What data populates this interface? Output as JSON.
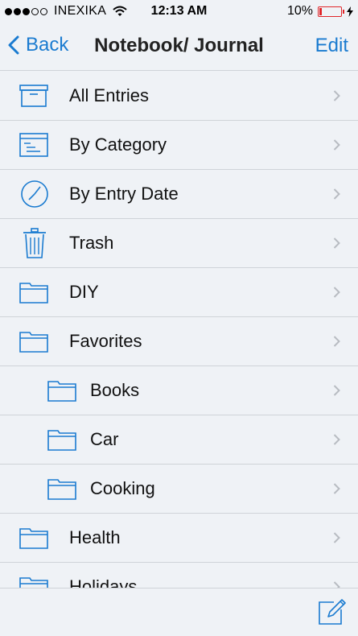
{
  "status_bar": {
    "carrier": "INEXIKA",
    "time": "12:13 AM",
    "battery": "10%"
  },
  "nav": {
    "back_label": "Back",
    "title": "Notebook/ Journal",
    "edit_label": "Edit"
  },
  "colors": {
    "accent": "#1a7bd0",
    "battery_low": "#e0262a"
  },
  "list": {
    "items": [
      {
        "label": "All Entries",
        "icon": "archive-box-icon",
        "indent": 0
      },
      {
        "label": "By Category",
        "icon": "category-list-icon",
        "indent": 0
      },
      {
        "label": "By Entry Date",
        "icon": "clock-icon",
        "indent": 0
      },
      {
        "label": "Trash",
        "icon": "trash-icon",
        "indent": 0
      },
      {
        "label": "DIY",
        "icon": "folder-icon",
        "indent": 0
      },
      {
        "label": "Favorites",
        "icon": "folder-icon",
        "indent": 0
      },
      {
        "label": "Books",
        "icon": "folder-icon",
        "indent": 1
      },
      {
        "label": "Car",
        "icon": "folder-icon",
        "indent": 1
      },
      {
        "label": "Cooking",
        "icon": "folder-icon",
        "indent": 1
      },
      {
        "label": "Health",
        "icon": "folder-icon",
        "indent": 0
      },
      {
        "label": "Holidays",
        "icon": "folder-icon",
        "indent": 0
      }
    ]
  },
  "toolbar": {
    "compose_icon": "compose-icon"
  }
}
